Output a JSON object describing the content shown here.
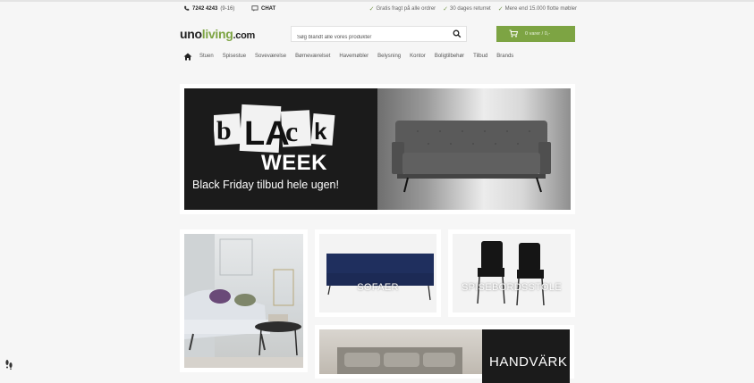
{
  "topbar": {
    "phone": "7242 4243",
    "hours": "(9-16)",
    "chat": "CHAT",
    "usps": [
      "Gratis fragt på alle ordrer",
      "30 dages returret",
      "Mere end 15.000 flotte møbler"
    ]
  },
  "header": {
    "logo_part1": "uno",
    "logo_part2": "living",
    "logo_part3": ".com",
    "search_placeholder": "Søg blandt alle vores produkter",
    "cart_label": "0 varer / 0,-"
  },
  "nav": {
    "items": [
      "Stuen",
      "Spisestue",
      "Soveværelse",
      "Børneværelset",
      "Havemøbler",
      "Belysning",
      "Kontor",
      "Boligtilbehør",
      "Tilbud",
      "Brands"
    ]
  },
  "hero": {
    "black_letters": "bLAck",
    "week": "WEEK",
    "subtitle": "Black Friday tilbud hele ugen!"
  },
  "categories": {
    "sofas": "SOFAER",
    "chairs": "SPISEBORDSSTOLE",
    "crafts": "HANDVÄRK"
  },
  "colors": {
    "accent": "#7da443",
    "dark": "#1b1b1b",
    "background": "#f6f6f6"
  }
}
